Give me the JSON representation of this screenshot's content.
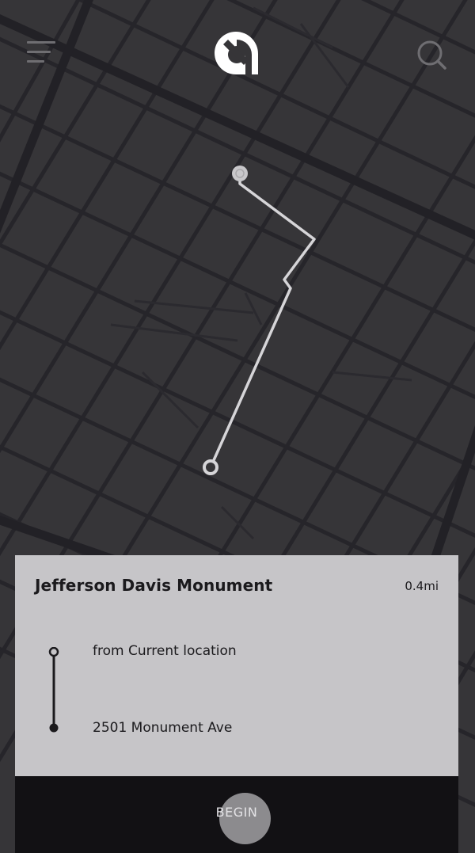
{
  "header": {
    "menu_icon": "hamburger-menu-icon",
    "logo_icon": "app-logo-icon",
    "search_icon": "search-icon"
  },
  "map": {
    "background_color": "#363538",
    "street_color": "#26252a",
    "route_color": "#d6d5d8"
  },
  "card": {
    "title": "Jefferson Davis Monument",
    "distance": "0.4mi",
    "from": "from Current location",
    "to": "2501 Monument Ave"
  },
  "action": {
    "begin_label": "BEGIN"
  }
}
